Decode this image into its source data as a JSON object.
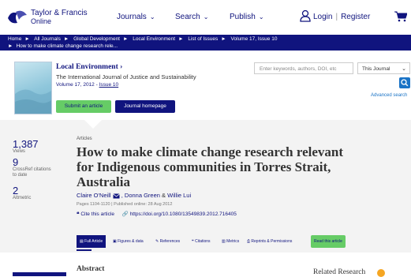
{
  "brand": {
    "name": "Taylor & Francis",
    "sub": "Online"
  },
  "nav": {
    "journals": "Journals",
    "search": "Search",
    "publish": "Publish",
    "login": "Login",
    "separator": "|",
    "register": "Register"
  },
  "breadcrumb": {
    "line1": [
      "Home",
      "All Journals",
      "Global Development",
      "Local Environment",
      "List of Issues",
      "Volume 17, Issue 10"
    ],
    "line2": "How to make climate change research rele..."
  },
  "journal": {
    "title": "Local Environment",
    "title_chevron": "›",
    "subtitle": "The International Journal of Justice and Sustainability",
    "volume_prefix": "Volume 17, 2012 - ",
    "issue_link": "Issue 10",
    "submit_label": "Submit an article",
    "homepage_label": "Journal homepage"
  },
  "search": {
    "placeholder": "Enter keywords, authors, DOI, etc",
    "scope": "This Journal",
    "advanced": "Advanced search"
  },
  "metrics": [
    {
      "value": "1,387",
      "label": "Views"
    },
    {
      "value": "9",
      "label": "CrossRef citations to date"
    },
    {
      "value": "2",
      "label": "Altmetric"
    }
  ],
  "article": {
    "type": "Articles",
    "title": "How to make climate change research relevant for Indigenous communities in Torres Strait, Australia",
    "authors": {
      "a1": "Claire O'Neill",
      "a2": "Donna Green",
      "a3": "Willie Lui",
      "amp": "&"
    },
    "pages": "Pages 1104-1120 | Published online: 28 Aug 2012",
    "cite_label": "Cite this article",
    "doi": "https://doi.org/10.1080/13549839.2012.716405"
  },
  "tabs": [
    "Full Article",
    "Figures & data",
    "References",
    "Citations",
    "Metrics",
    "Reprints & Permissions",
    "Read this article"
  ],
  "abstract_heading": "Abstract",
  "related_heading": "Related Research",
  "colors": {
    "brand": "#10147e",
    "accent_green": "#66cc66",
    "link_blue": "#1a73c6",
    "panel_gray": "#f3f3f3"
  }
}
